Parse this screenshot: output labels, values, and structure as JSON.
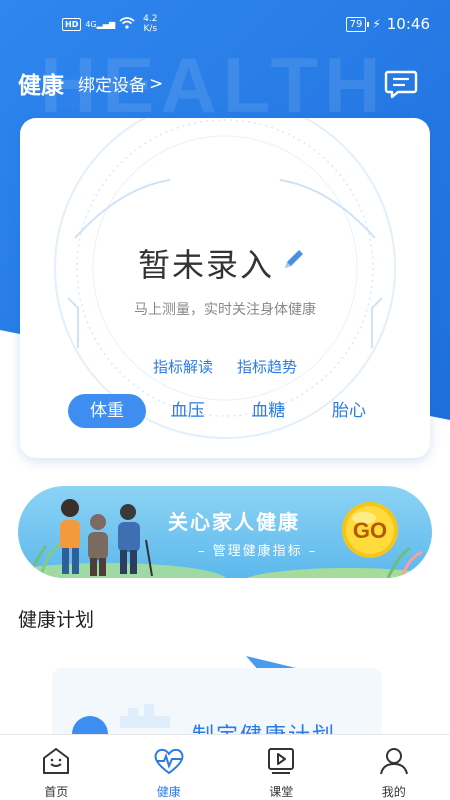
{
  "status_bar": {
    "network": "4G",
    "hd": "HD",
    "speed_value": "4.2",
    "speed_unit": "K/s",
    "battery": "79",
    "time": "10:46"
  },
  "header": {
    "title": "健康",
    "bind_device": "绑定设备",
    "bind_chevron": ">",
    "watermark": "HEALTH"
  },
  "card": {
    "status": "暂未录入",
    "subtitle": "马上测量，实时关注身体健康",
    "links": [
      "指标解读",
      "指标趋势"
    ],
    "metrics": [
      "体重",
      "血压",
      "血糖",
      "胎心"
    ],
    "active_metric": 0
  },
  "banner": {
    "title": "关心家人健康",
    "subtitle": "– 管理健康指标 –",
    "go": "GO"
  },
  "plan": {
    "section_title": "健康计划",
    "card_text": "制定健康计划"
  },
  "tabbar": {
    "items": [
      "首页",
      "健康",
      "课堂",
      "我的"
    ],
    "active": 1
  },
  "colors": {
    "brand_blue": "#2c7be5",
    "hero_blue": "#1e88e5",
    "active_tab": "#3d8ef0"
  }
}
